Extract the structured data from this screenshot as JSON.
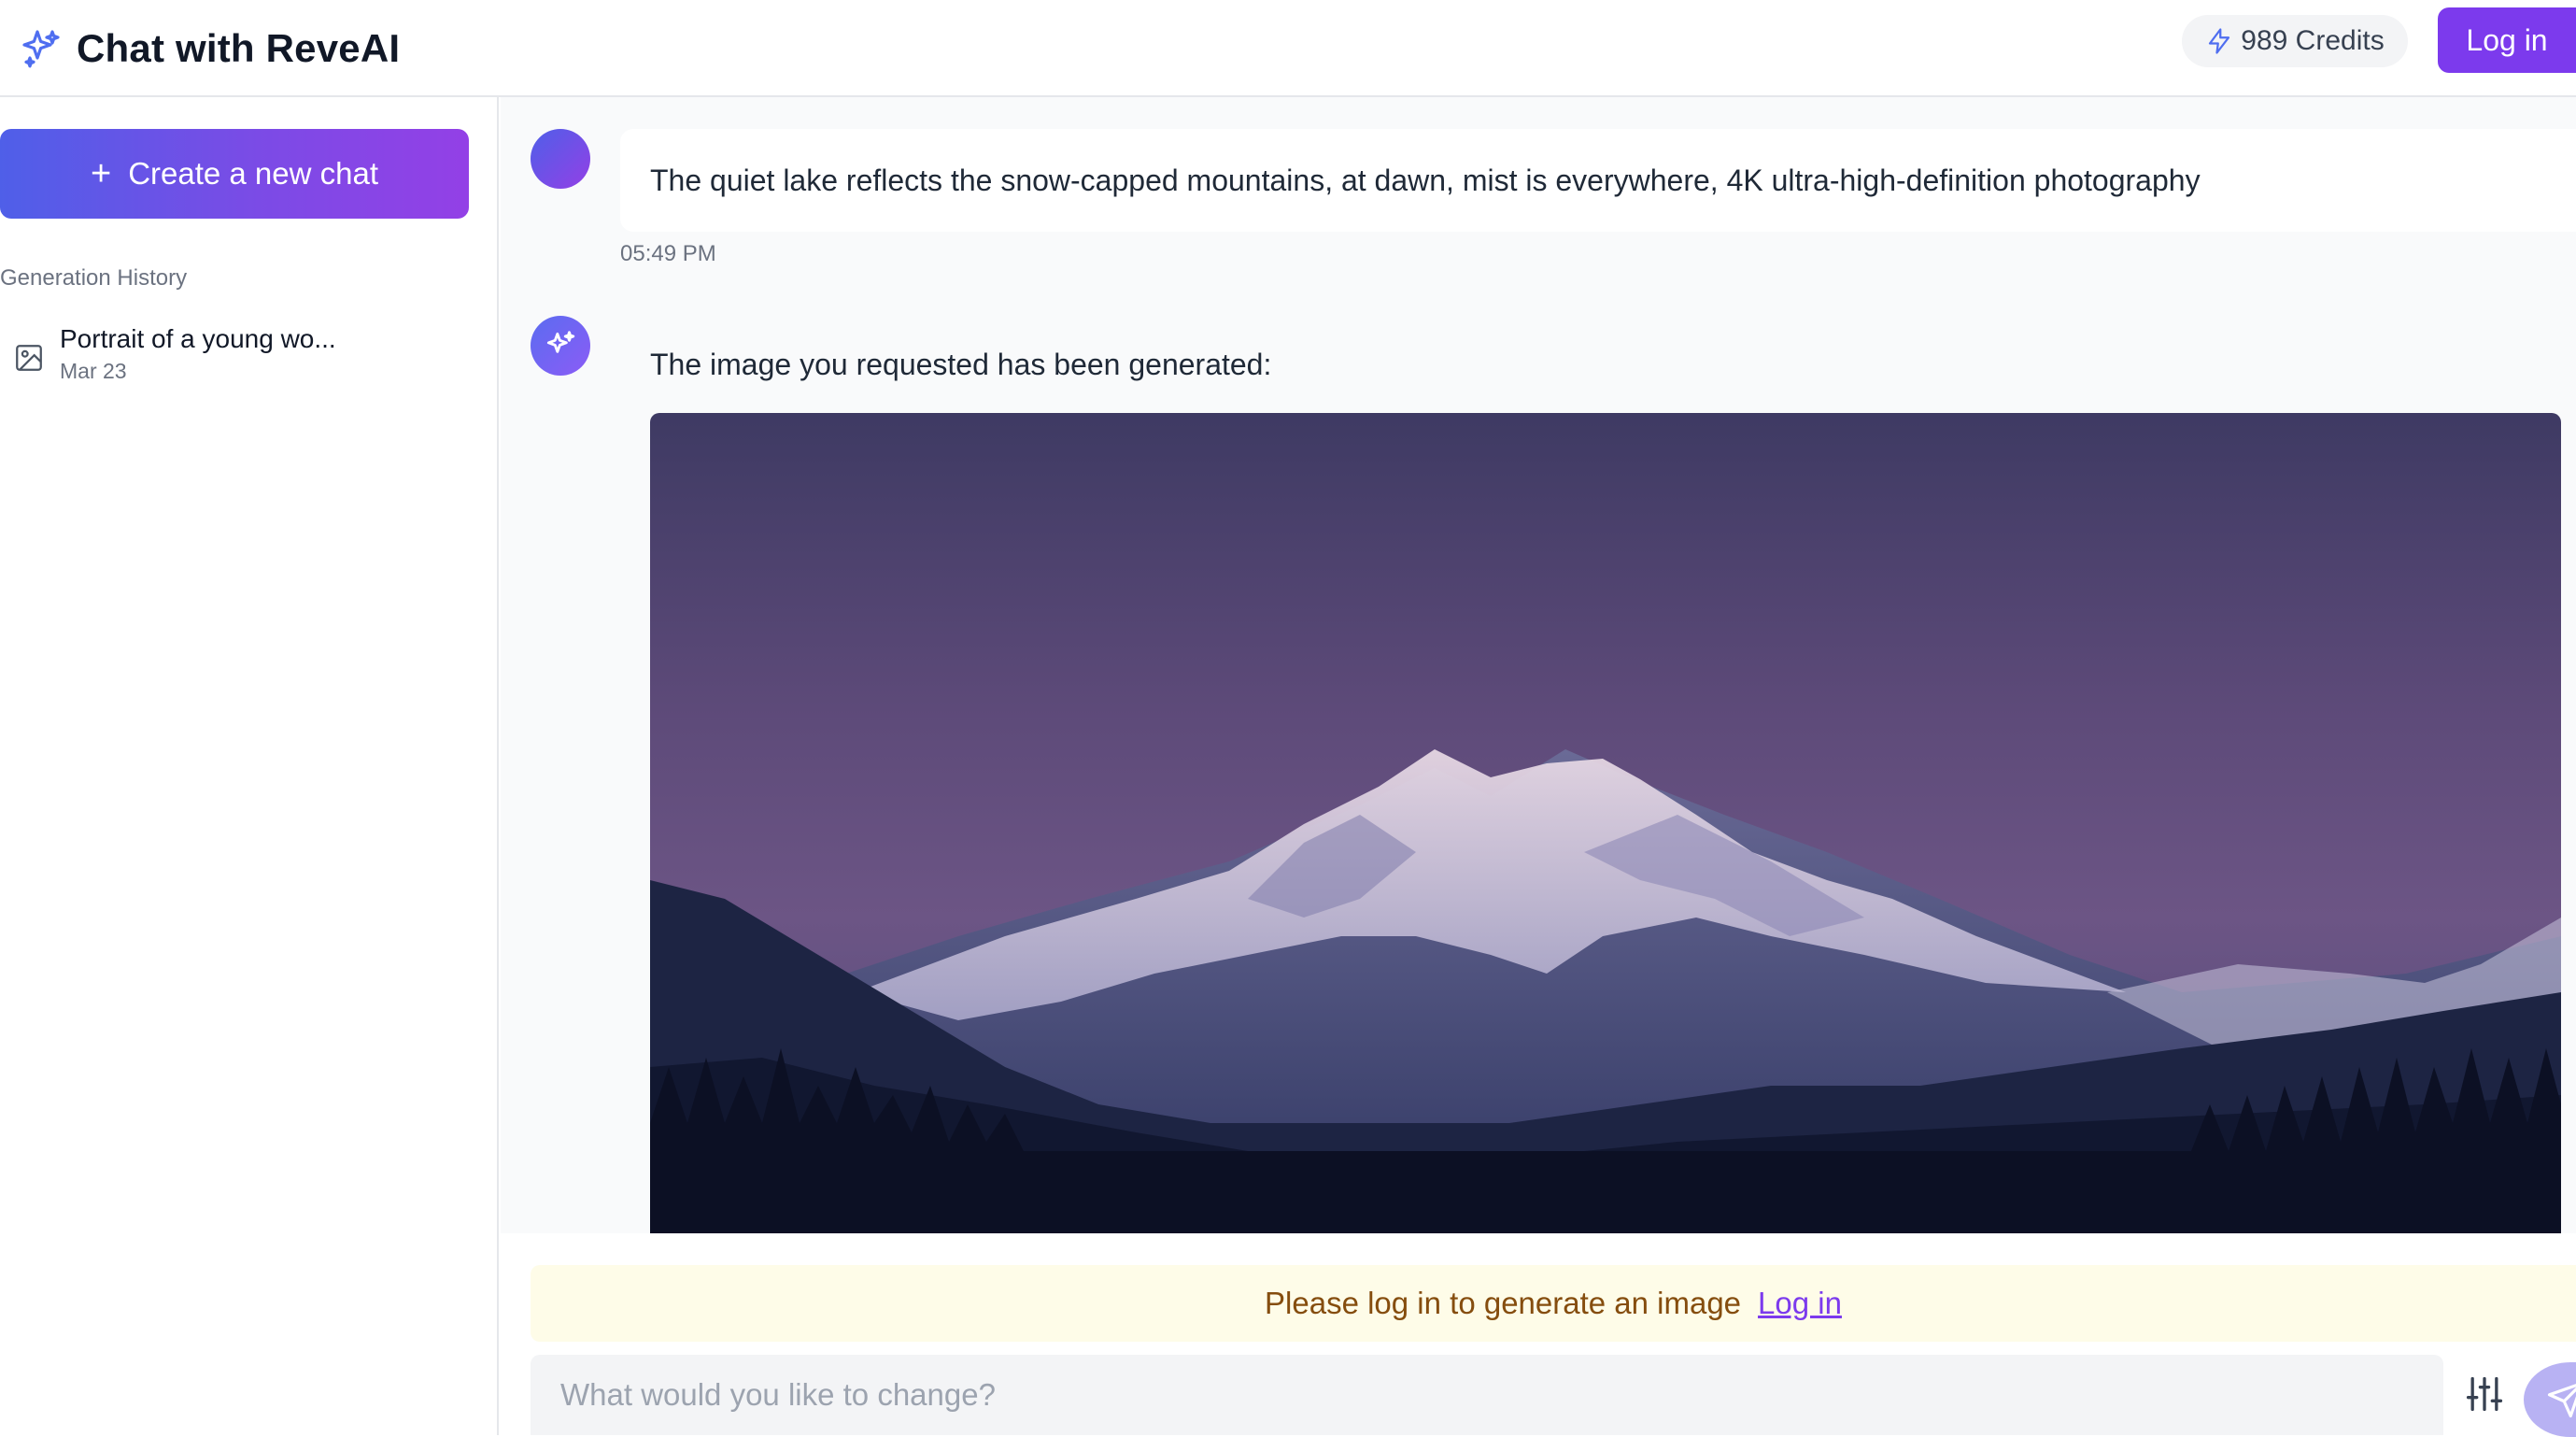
{
  "header": {
    "title": "Chat with ReveAI",
    "credits": "989 Credits",
    "login_label": "Log in"
  },
  "sidebar": {
    "new_chat_label": "Create a new chat",
    "history_title": "Generation History",
    "history": [
      {
        "title": "Portrait of a young wo...",
        "date": "Mar 23"
      }
    ]
  },
  "chat": {
    "user_prompt": "The quiet lake reflects the snow-capped mountains, at dawn, mist is everywhere, 4K ultra-high-definition photography",
    "timestamp": "05:49 PM",
    "ai_message": "The image you requested has been generated:"
  },
  "composer": {
    "login_notice": "Please log in to generate an image",
    "login_link": "Log in",
    "placeholder": "What would you like to change?"
  },
  "colors": {
    "accent": "#7c3aed",
    "gradient_start": "#4f5fe8",
    "gradient_end": "#9340e6",
    "notice_bg": "#fefce8"
  },
  "icons": {
    "brand": "sparkles-icon",
    "credits": "lightning-icon",
    "history_item": "image-icon",
    "ai_avatar": "sparkles-icon",
    "settings": "sliders-icon",
    "send": "send-icon"
  }
}
